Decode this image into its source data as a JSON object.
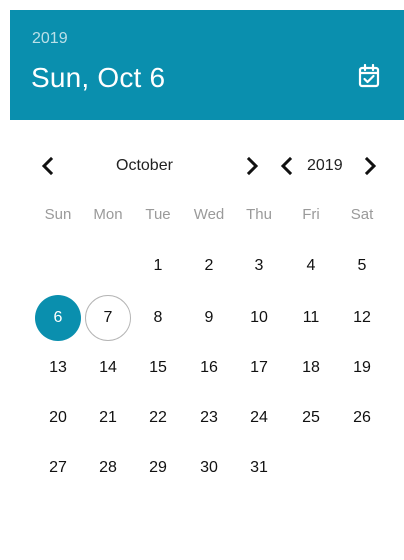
{
  "header": {
    "year": "2019",
    "date": "Sun, Oct 6"
  },
  "nav": {
    "month": "October",
    "year": "2019"
  },
  "weekdays": [
    "Sun",
    "Mon",
    "Tue",
    "Wed",
    "Thu",
    "Fri",
    "Sat"
  ],
  "days": [
    {
      "label": "1",
      "col": 2,
      "row": 0
    },
    {
      "label": "2",
      "col": 3,
      "row": 0
    },
    {
      "label": "3",
      "col": 4,
      "row": 0
    },
    {
      "label": "4",
      "col": 5,
      "row": 0
    },
    {
      "label": "5",
      "col": 6,
      "row": 0
    },
    {
      "label": "6",
      "col": 0,
      "row": 1,
      "state": "selected"
    },
    {
      "label": "7",
      "col": 1,
      "row": 1,
      "state": "today"
    },
    {
      "label": "8",
      "col": 2,
      "row": 1
    },
    {
      "label": "9",
      "col": 3,
      "row": 1
    },
    {
      "label": "10",
      "col": 4,
      "row": 1
    },
    {
      "label": "11",
      "col": 5,
      "row": 1
    },
    {
      "label": "12",
      "col": 6,
      "row": 1
    },
    {
      "label": "13",
      "col": 0,
      "row": 2
    },
    {
      "label": "14",
      "col": 1,
      "row": 2
    },
    {
      "label": "15",
      "col": 2,
      "row": 2
    },
    {
      "label": "16",
      "col": 3,
      "row": 2
    },
    {
      "label": "17",
      "col": 4,
      "row": 2
    },
    {
      "label": "18",
      "col": 5,
      "row": 2
    },
    {
      "label": "19",
      "col": 6,
      "row": 2
    },
    {
      "label": "20",
      "col": 0,
      "row": 3
    },
    {
      "label": "21",
      "col": 1,
      "row": 3
    },
    {
      "label": "22",
      "col": 2,
      "row": 3
    },
    {
      "label": "23",
      "col": 3,
      "row": 3
    },
    {
      "label": "24",
      "col": 4,
      "row": 3
    },
    {
      "label": "25",
      "col": 5,
      "row": 3
    },
    {
      "label": "26",
      "col": 6,
      "row": 3
    },
    {
      "label": "27",
      "col": 0,
      "row": 4
    },
    {
      "label": "28",
      "col": 1,
      "row": 4
    },
    {
      "label": "29",
      "col": 2,
      "row": 4
    },
    {
      "label": "30",
      "col": 3,
      "row": 4
    },
    {
      "label": "31",
      "col": 4,
      "row": 4
    }
  ],
  "colors": {
    "accent": "#0a8fae",
    "today_ring": "#b5b5b5",
    "weekday_text": "#9a9a9a"
  },
  "icons": {
    "calendar": "calendar-check-icon",
    "prev": "chevron-left-icon",
    "next": "chevron-right-icon"
  }
}
